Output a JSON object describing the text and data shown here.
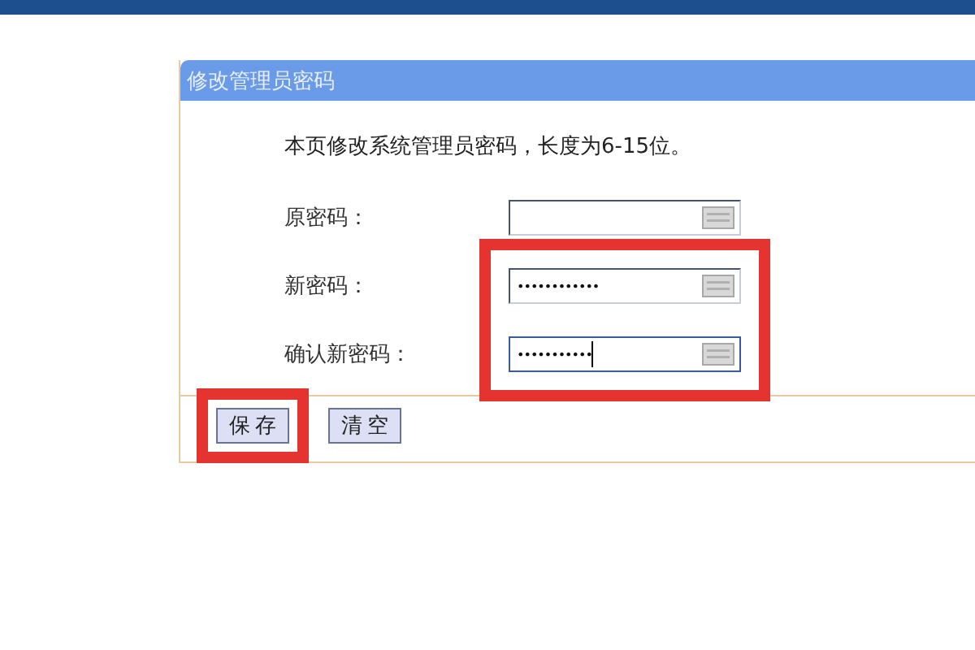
{
  "panel": {
    "title": "修改管理员密码",
    "description": "本页修改系统管理员密码，长度为6-15位。"
  },
  "fields": [
    {
      "label": "原密码：",
      "focused": false,
      "highlighted": false
    },
    {
      "label": "新密码：",
      "value": "••••••••••••",
      "focused": false,
      "highlighted": true
    },
    {
      "label": "确认新密码：",
      "value": "•••••••••••",
      "focused": true,
      "highlighted": true
    }
  ],
  "buttons": [
    {
      "label": "保存",
      "highlighted": true
    },
    {
      "label": "清空",
      "highlighted": false
    }
  ]
}
